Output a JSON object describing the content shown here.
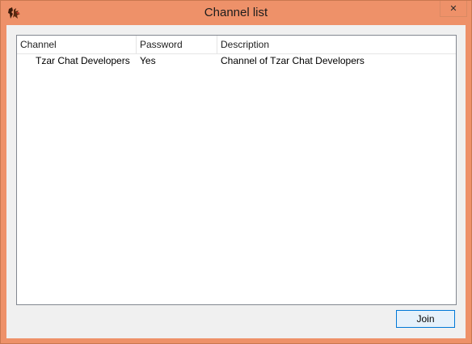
{
  "window": {
    "title": "Channel list"
  },
  "titlebar": {
    "close_glyph": "✕",
    "app_icon": "tzar-app-icon"
  },
  "list": {
    "columns": [
      "Channel",
      "Password",
      "Description"
    ],
    "rows": [
      {
        "channel": "Tzar Chat Developers",
        "password": "Yes",
        "description": "Channel of Tzar Chat Developers"
      }
    ]
  },
  "buttons": {
    "join_label": "Join"
  },
  "colors": {
    "frame": "#ee9169",
    "client": "#f0f0f0",
    "button_border": "#0078d7"
  }
}
